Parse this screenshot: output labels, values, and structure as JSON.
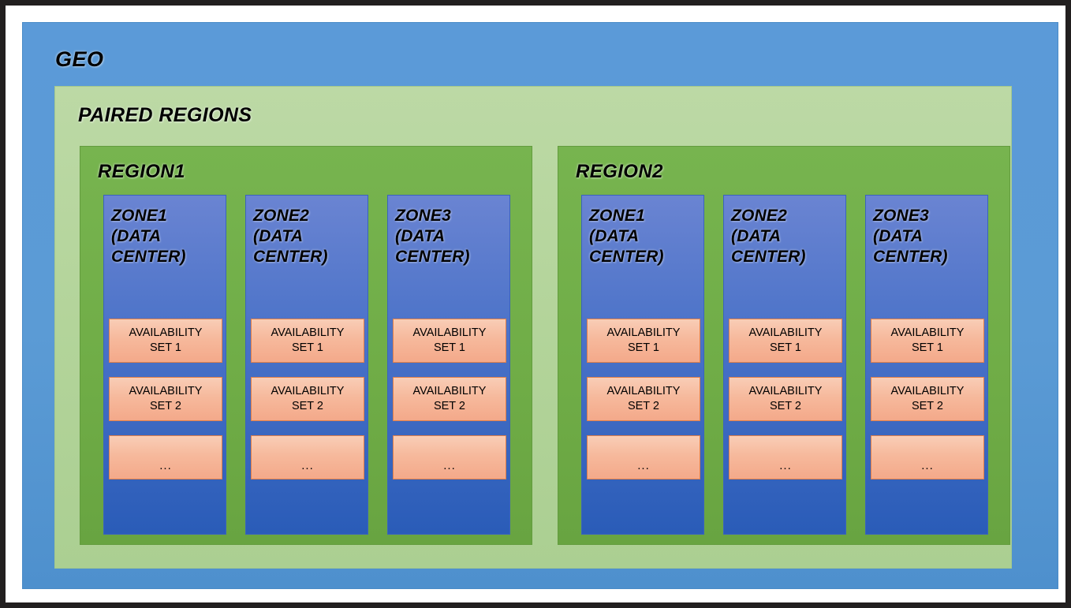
{
  "diagram": {
    "title": "Azure Geo / Paired Regions / Zones / Availability Sets hierarchy",
    "colors": {
      "frame_border": "#221f1f",
      "geo_blue": "#5b9bd5",
      "paired_regions_green": "#b3d49a",
      "region_green": "#70ad47",
      "zone_blue_top": "#6a84d2",
      "zone_blue_bottom": "#2a5cb8",
      "availability_set_peach": "#f6b99c",
      "availability_set_border": "#e07f49",
      "text_color": "#000000"
    }
  },
  "geo": {
    "label": "GEO"
  },
  "paired_regions": {
    "label": "PAIRED REGIONS",
    "regions": [
      {
        "label": "REGION1",
        "zones": [
          {
            "label": "ZONE1\n(DATA\nCENTER)",
            "availability_sets": [
              {
                "label": "AVAILABILITY\nSET 1"
              },
              {
                "label": "AVAILABILITY\nSET 2"
              },
              {
                "label": "..."
              }
            ]
          },
          {
            "label": "ZONE2\n(DATA\nCENTER)",
            "availability_sets": [
              {
                "label": "AVAILABILITY\nSET 1"
              },
              {
                "label": "AVAILABILITY\nSET 2"
              },
              {
                "label": "..."
              }
            ]
          },
          {
            "label": "ZONE3\n(DATA\nCENTER)",
            "availability_sets": [
              {
                "label": "AVAILABILITY\nSET 1"
              },
              {
                "label": "AVAILABILITY\nSET 2"
              },
              {
                "label": "..."
              }
            ]
          }
        ]
      },
      {
        "label": "REGION2",
        "zones": [
          {
            "label": "ZONE1\n(DATA\nCENTER)",
            "availability_sets": [
              {
                "label": "AVAILABILITY\nSET 1"
              },
              {
                "label": "AVAILABILITY\nSET 2"
              },
              {
                "label": "..."
              }
            ]
          },
          {
            "label": "ZONE2\n(DATA\nCENTER)",
            "availability_sets": [
              {
                "label": "AVAILABILITY\nSET 1"
              },
              {
                "label": "AVAILABILITY\nSET 2"
              },
              {
                "label": "..."
              }
            ]
          },
          {
            "label": "ZONE3\n(DATA\nCENTER)",
            "availability_sets": [
              {
                "label": "AVAILABILITY\nSET 1"
              },
              {
                "label": "AVAILABILITY\nSET 2"
              },
              {
                "label": "..."
              }
            ]
          }
        ]
      }
    ]
  }
}
